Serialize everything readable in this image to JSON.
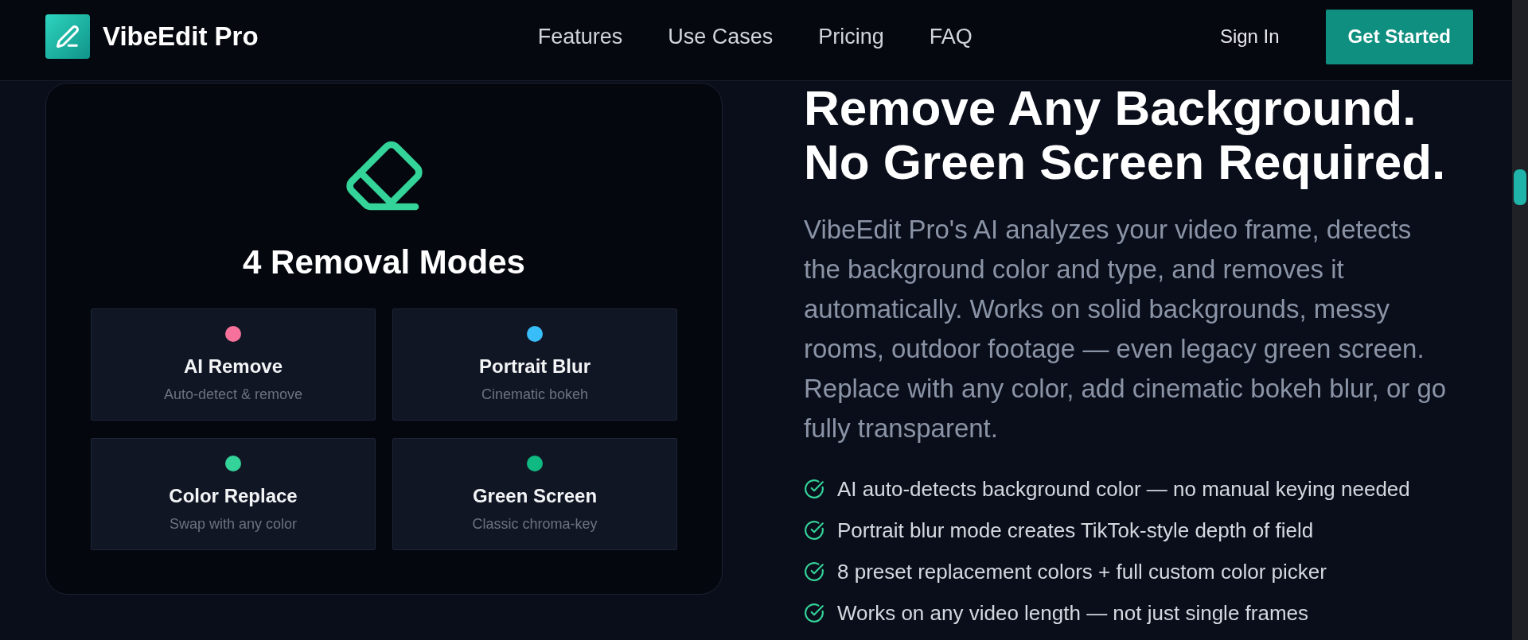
{
  "nav": {
    "brand": "VibeEdit Pro",
    "links": [
      "Features",
      "Use Cases",
      "Pricing",
      "FAQ"
    ],
    "sign_in": "Sign In",
    "cta": "Get Started"
  },
  "modes_card": {
    "title": "4 Removal Modes",
    "modes": [
      {
        "name": "AI Remove",
        "description": "Auto-detect & remove",
        "color": "#f7729b"
      },
      {
        "name": "Portrait Blur",
        "description": "Cinematic bokeh",
        "color": "#38bdf8"
      },
      {
        "name": "Color Replace",
        "description": "Swap with any color",
        "color": "#34d399"
      },
      {
        "name": "Green Screen",
        "description": "Classic chroma-key",
        "color": "#10b981"
      }
    ]
  },
  "hero": {
    "heading": "Remove Any Background. No Green Screen Required.",
    "description": "VibeEdit Pro's AI analyzes your video frame, detects the background color and type, and removes it automatically. Works on solid backgrounds, messy rooms, outdoor footage — even legacy green screen. Replace with any color, add cinematic bokeh blur, or go fully transparent.",
    "features": [
      "AI auto-detects background color — no manual keying needed",
      "Portrait blur mode creates TikTok-style depth of field",
      "8 preset replacement colors + full custom color picker",
      "Works on any video length — not just single frames"
    ]
  }
}
